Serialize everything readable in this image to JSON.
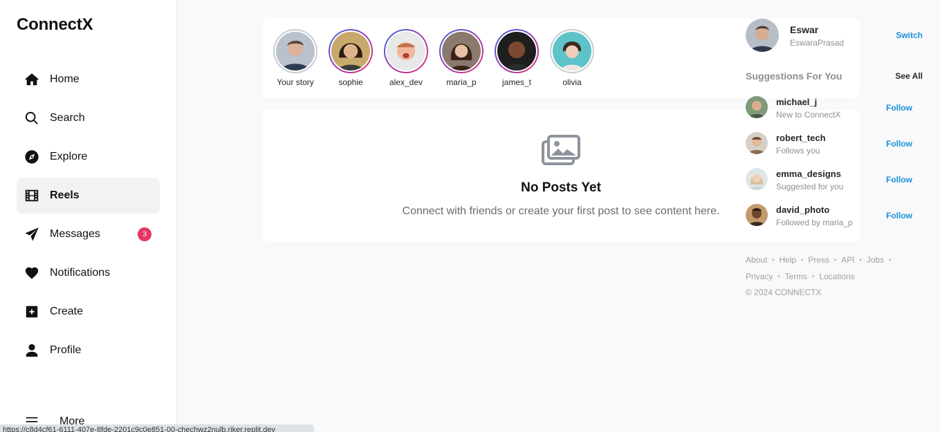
{
  "app": {
    "title": "ConnectX"
  },
  "sidebar": {
    "items": [
      {
        "label": "Home",
        "icon": "home-icon"
      },
      {
        "label": "Search",
        "icon": "search-icon"
      },
      {
        "label": "Explore",
        "icon": "compass-icon"
      },
      {
        "label": "Reels",
        "icon": "film-icon",
        "active": true
      },
      {
        "label": "Messages",
        "icon": "send-icon",
        "badge": "3"
      },
      {
        "label": "Notifications",
        "icon": "heart-icon"
      },
      {
        "label": "Create",
        "icon": "plus-square-icon"
      },
      {
        "label": "Profile",
        "icon": "user-icon"
      }
    ],
    "more_label": "More"
  },
  "status_url": "https://c8d4cf61-6111-407e-8fde-2201c9c0e851-00-chechwz2nulb.riker.replit.dev",
  "stories": [
    {
      "name": "Your story",
      "own": true
    },
    {
      "name": "sophie"
    },
    {
      "name": "alex_dev"
    },
    {
      "name": "maria_p"
    },
    {
      "name": "james_t"
    },
    {
      "name": "olivia"
    }
  ],
  "posts": {
    "empty_title": "No Posts Yet",
    "empty_text": "Connect with friends or create your first post to see content here."
  },
  "me": {
    "name": "Eswar",
    "handle": "EswaraPrasad",
    "switch_label": "Switch"
  },
  "suggestions": {
    "title": "Suggestions For You",
    "see_all": "See All",
    "follow_label": "Follow",
    "items": [
      {
        "name": "michael_j",
        "sub": "New to ConnectX"
      },
      {
        "name": "robert_tech",
        "sub": "Follows you"
      },
      {
        "name": "emma_designs",
        "sub": "Suggested for you"
      },
      {
        "name": "david_photo",
        "sub": "Followed by maria_p"
      }
    ]
  },
  "footer": {
    "links_row1": [
      "About",
      "Help",
      "Press",
      "API",
      "Jobs"
    ],
    "links_row2": [
      "Privacy",
      "Terms",
      "Locations"
    ],
    "copyright": "© 2024 CONNECTX"
  },
  "colors": {
    "accent": "#1a8fd8",
    "badge": "#e53662",
    "active_bg": "#f1f2f4"
  }
}
